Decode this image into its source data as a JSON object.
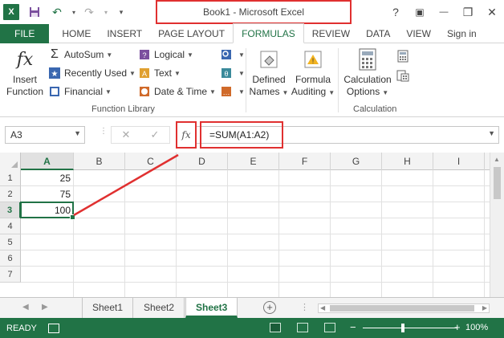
{
  "window": {
    "title": "Book1 - Microsoft Excel",
    "help": "?",
    "ribbon_display": "▣",
    "minimize": "—",
    "restore": "❐",
    "close": "✕"
  },
  "qat": {
    "logo": "X",
    "save": "💾",
    "undo": "↶",
    "redo": "↷",
    "customize": "▾"
  },
  "tabs": [
    "FILE",
    "HOME",
    "INSERT",
    "PAGE LAYOUT",
    "FORMULAS",
    "REVIEW",
    "DATA",
    "VIEW",
    "Sign in"
  ],
  "active_tab": "FORMULAS",
  "ribbon": {
    "insert_function": {
      "line1": "Insert",
      "line2": "Function",
      "icon": "fx"
    },
    "function_library": {
      "label": "Function Library",
      "autosum": "AutoSum",
      "recently_used": "Recently Used",
      "financial": "Financial",
      "logical": "Logical",
      "text": "Text",
      "date_time": "Date & Time"
    },
    "defined_names": {
      "line1": "Defined",
      "line2": "Names"
    },
    "formula_auditing": {
      "line1": "Formula",
      "line2": "Auditing"
    },
    "calculation": {
      "label": "Calculation",
      "line1": "Calculation",
      "line2": "Options"
    }
  },
  "formula_bar": {
    "name_box": "A3",
    "cancel": "✕",
    "enter": "✓",
    "fx": "fx",
    "formula": "=SUM(A1:A2)"
  },
  "grid": {
    "columns": [
      "A",
      "B",
      "C",
      "D",
      "E",
      "F",
      "G",
      "H",
      "I"
    ],
    "rows": [
      "1",
      "2",
      "3",
      "4",
      "5",
      "6",
      "7"
    ],
    "cells": {
      "A1": "25",
      "A2": "75",
      "A3": "100"
    },
    "active_cell": "A3"
  },
  "sheets": [
    "Sheet1",
    "Sheet2",
    "Sheet3"
  ],
  "active_sheet": "Sheet3",
  "status": {
    "ready": "READY",
    "zoom": "100%",
    "zoom_out": "−",
    "zoom_in": "+"
  },
  "colors": {
    "excel_green": "#217346",
    "annotation_red": "#e03030"
  }
}
